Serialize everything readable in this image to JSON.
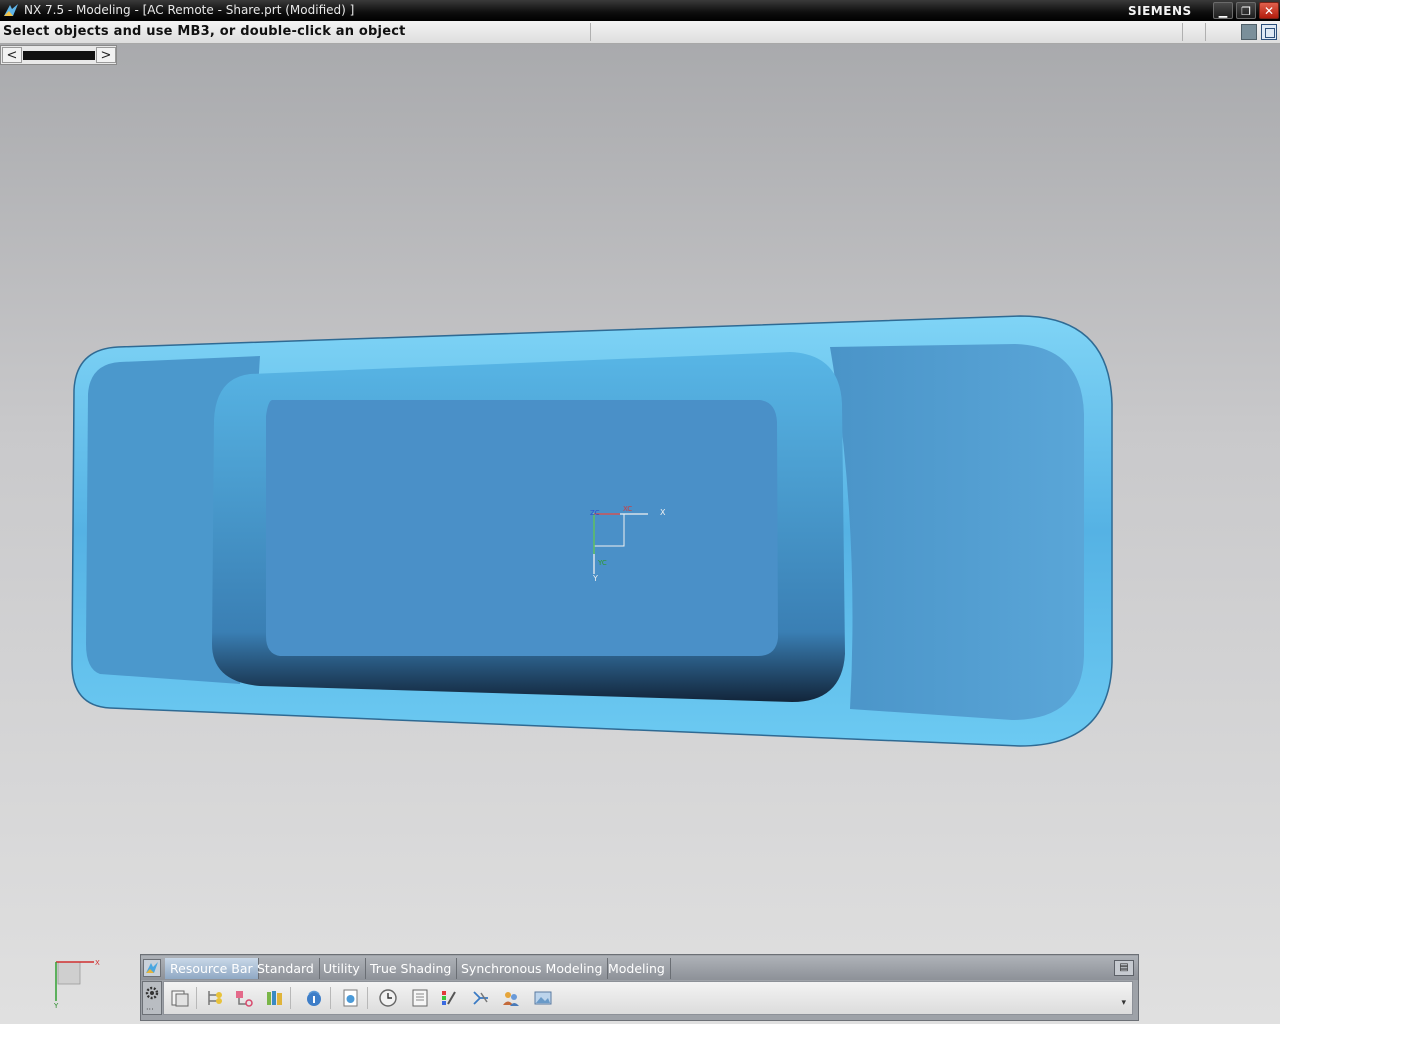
{
  "window": {
    "title": "NX 7.5 - Modeling - [AC Remote - Share.prt (Modified) ]",
    "brand": "SIEMENS",
    "controls": {
      "minimize": "▁",
      "maximize": "❐",
      "close": "✕"
    }
  },
  "statusbar": {
    "prompt": "Select objects and use MB3, or double-click an object"
  },
  "navigator": {
    "left": "<",
    "right": ">"
  },
  "viewport": {
    "wcs_labels": {
      "zc": "ZC",
      "xc": "XC",
      "yc": "YC",
      "x": "X",
      "y": "Y"
    },
    "model_color": "#4a90c8",
    "triad_labels": {
      "x": "X",
      "y": "Y"
    }
  },
  "toolbar": {
    "tabs": [
      {
        "label": "Resource Bar",
        "active": true
      },
      {
        "label": "Standard",
        "active": false
      },
      {
        "label": "Utility",
        "active": false
      },
      {
        "label": "True Shading",
        "active": false
      },
      {
        "label": "Synchronous Modeling",
        "active": false
      },
      {
        "label": "Modeling",
        "active": false
      }
    ],
    "icons": [
      "assembly-navigator-icon",
      "part-navigator-icon",
      "constraint-navigator-icon",
      "reuse-library-icon",
      "web-browser-icon",
      "history-icon",
      "clock-icon",
      "system-materials-icon",
      "palette-icon",
      "process-studio-icon",
      "roles-icon",
      "system-scenes-icon"
    ],
    "menu_icon": "menu-icon",
    "gear_icon": "gear-icon"
  }
}
